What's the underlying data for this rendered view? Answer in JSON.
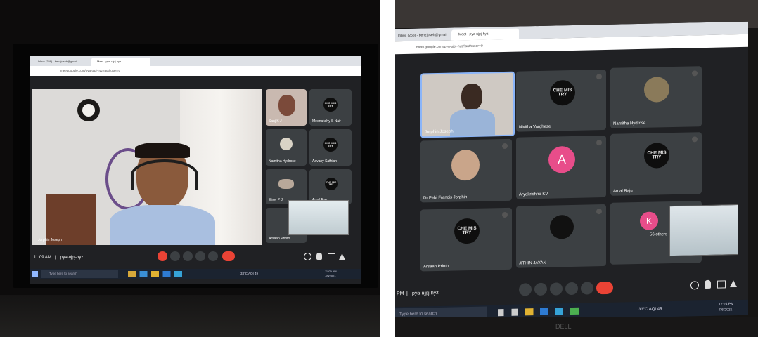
{
  "left_photo": {
    "browser": {
      "tab1": "Inbox (258) - benzjoseh@gmai",
      "tab2": "Meet - pya-ujpj-hyz",
      "url": "meet.google.com/pya-ujpj-hyz?authuser=0"
    },
    "main_speaker": "Jorphin Joseph",
    "tiles": [
      "Sanj K J",
      "Meenakshy S Nair",
      "Namitha Hydrose",
      "Aavany Sathian",
      "Elroy P J",
      "Amal Raju",
      "Arsaan Printo"
    ],
    "bottom_bar": {
      "time": "11:09 AM",
      "meeting_code": "pya-ujpj-hyz"
    },
    "taskbar": {
      "search": "Type here to search",
      "weather": "33°C AQI 49",
      "clock_time": "11:09 AM",
      "clock_date": "7/6/2021"
    }
  },
  "right_photo": {
    "browser": {
      "tab1": "Inbox (258) - benzjoseh@gmai",
      "tab2": "Meet - pya-ujpj-hyz",
      "url": "meet.google.com/pya-ujpj-hyz?authuser=0"
    },
    "tiles": [
      {
        "name": "Jorphin Joseph"
      },
      {
        "name": "Nivitha Varghese"
      },
      {
        "name": "Namitha Hydrose"
      },
      {
        "name": "Dr Febi Francis Jorphin"
      },
      {
        "name": "Aryakrishna KV",
        "avatar_letter": "A",
        "avatar_color": "#e84d8a"
      },
      {
        "name": "Amal Raju"
      },
      {
        "name": "Arsaan Printo"
      },
      {
        "name": "JITHIN JAYAN"
      },
      {
        "name": "56 others",
        "avatar_letter": "K",
        "avatar_color": "#e84d8a"
      }
    ],
    "chemistry_logo": "CHE MIS TRY",
    "bottom_bar": {
      "time": "PM",
      "meeting_code": "pya-ujpj-hyz"
    },
    "taskbar": {
      "search": "Type here to search",
      "weather": "33°C AQI 49",
      "clock_time": "12:24 PM",
      "clock_date": "7/6/2021"
    },
    "monitor_brand": "DELL"
  }
}
